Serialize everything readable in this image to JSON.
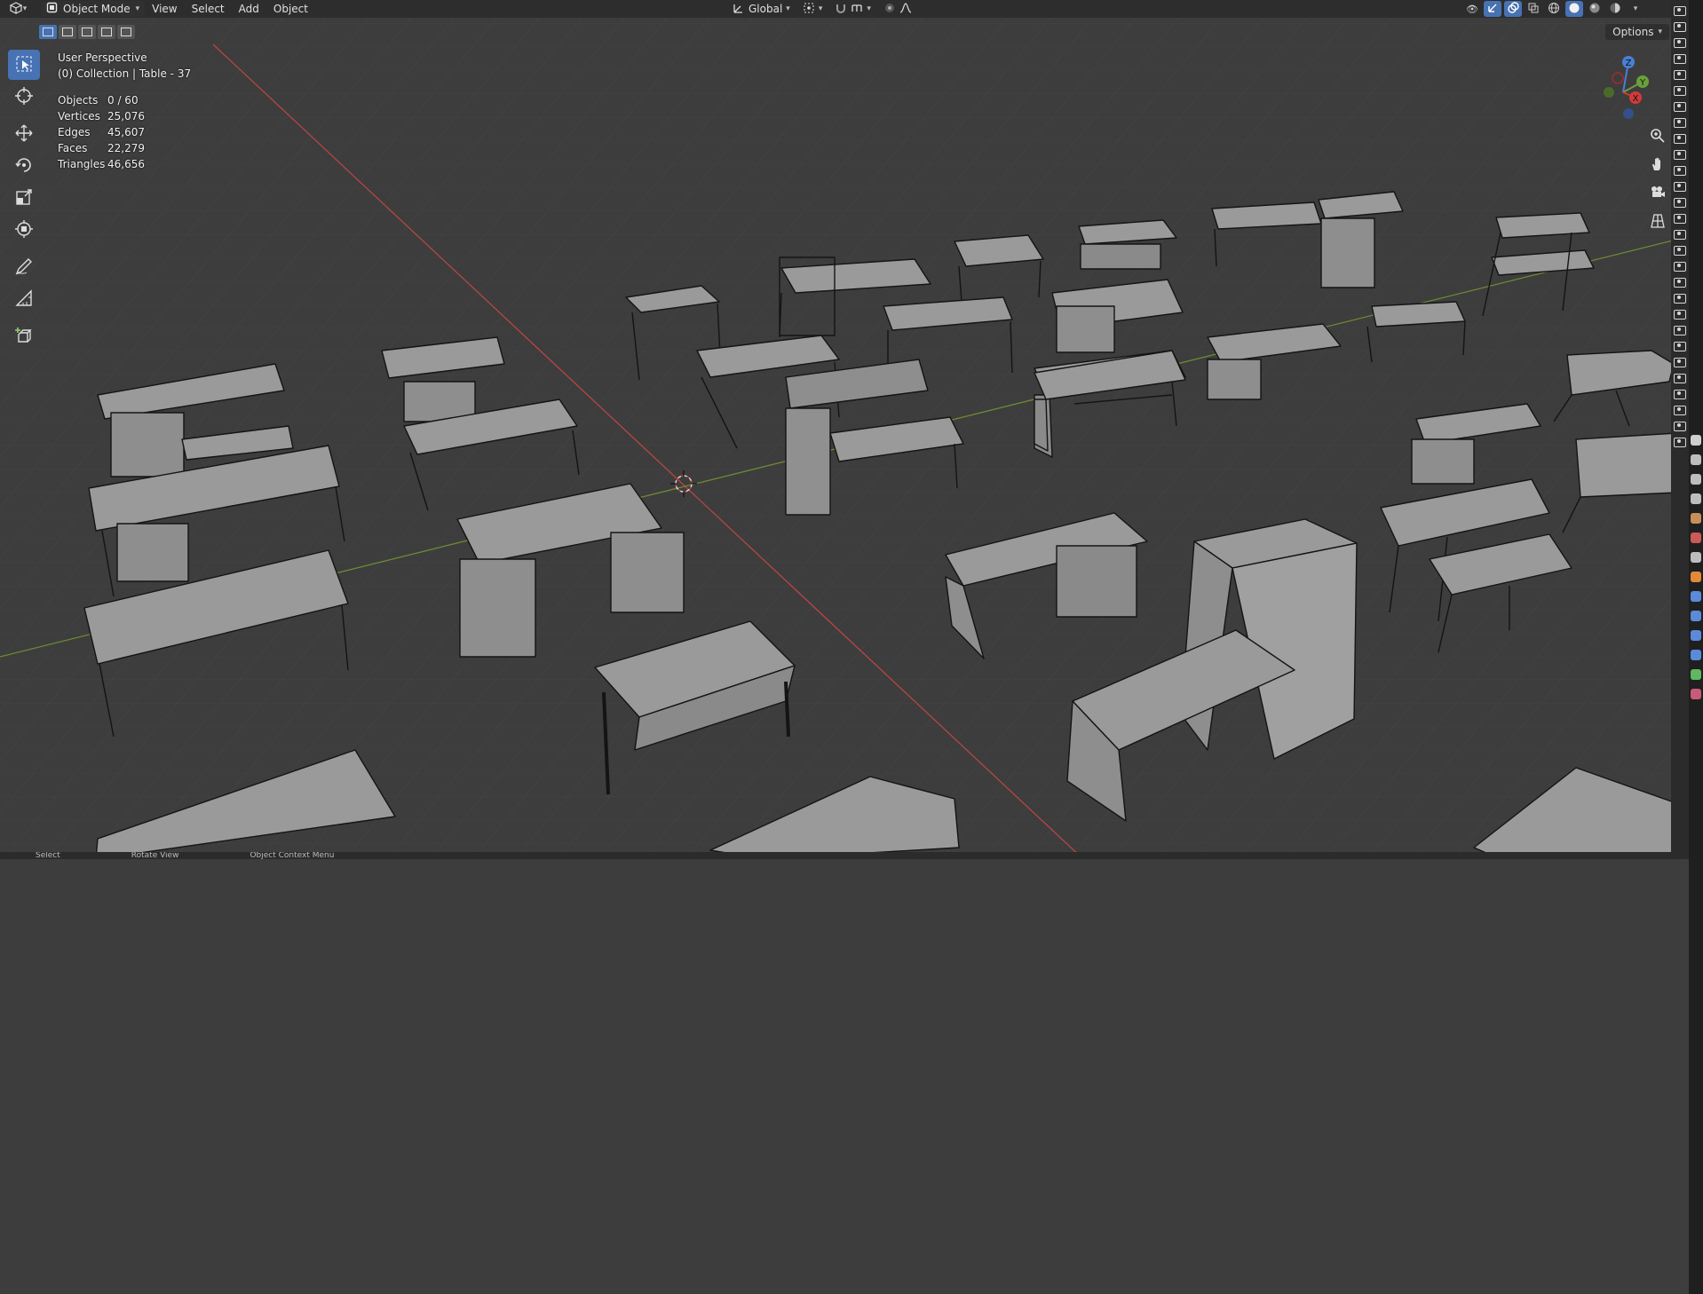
{
  "header": {
    "mode": "Object Mode",
    "menus": [
      "View",
      "Select",
      "Add",
      "Object"
    ],
    "transform_orientation": "Global",
    "editor_type_icon": "3d-viewport-icon"
  },
  "options_label": "Options",
  "overlay": {
    "view_name": "User Perspective",
    "collection_info": "(0) Collection | Table - 37",
    "stats": [
      {
        "label": "Objects",
        "value": "0 / 60"
      },
      {
        "label": "Vertices",
        "value": "25,076"
      },
      {
        "label": "Edges",
        "value": "45,607"
      },
      {
        "label": "Faces",
        "value": "22,279"
      },
      {
        "label": "Triangles",
        "value": "46,656"
      }
    ]
  },
  "gizmo": {
    "z_label": "Z",
    "y_label": "Y",
    "x_label": "X"
  },
  "tools": [
    {
      "name": "select-box-tool",
      "icon": "select-box-icon",
      "active": true
    },
    {
      "name": "cursor-tool",
      "icon": "cursor-icon",
      "active": false
    },
    {
      "name": "move-tool",
      "icon": "move-icon",
      "active": false
    },
    {
      "name": "rotate-tool",
      "icon": "rotate-icon",
      "active": false
    },
    {
      "name": "scale-tool",
      "icon": "scale-icon",
      "active": false
    },
    {
      "name": "transform-tool",
      "icon": "transform-icon",
      "active": false
    },
    {
      "name": "annotate-tool",
      "icon": "annotate-icon",
      "active": false
    },
    {
      "name": "measure-tool",
      "icon": "measure-icon",
      "active": false
    },
    {
      "name": "add-cube-tool",
      "icon": "add-cube-icon",
      "active": false
    }
  ],
  "colors": {
    "accent": "#4772b3",
    "grid_bg": "#3d3d3d",
    "x_axis": "#c94444",
    "y_axis": "#7fa33a",
    "mesh_face": "#979797",
    "mesh_edge": "#111111"
  },
  "statusbar": {
    "left": "Select",
    "middle": "Rotate View",
    "right": "Object Context Menu"
  }
}
